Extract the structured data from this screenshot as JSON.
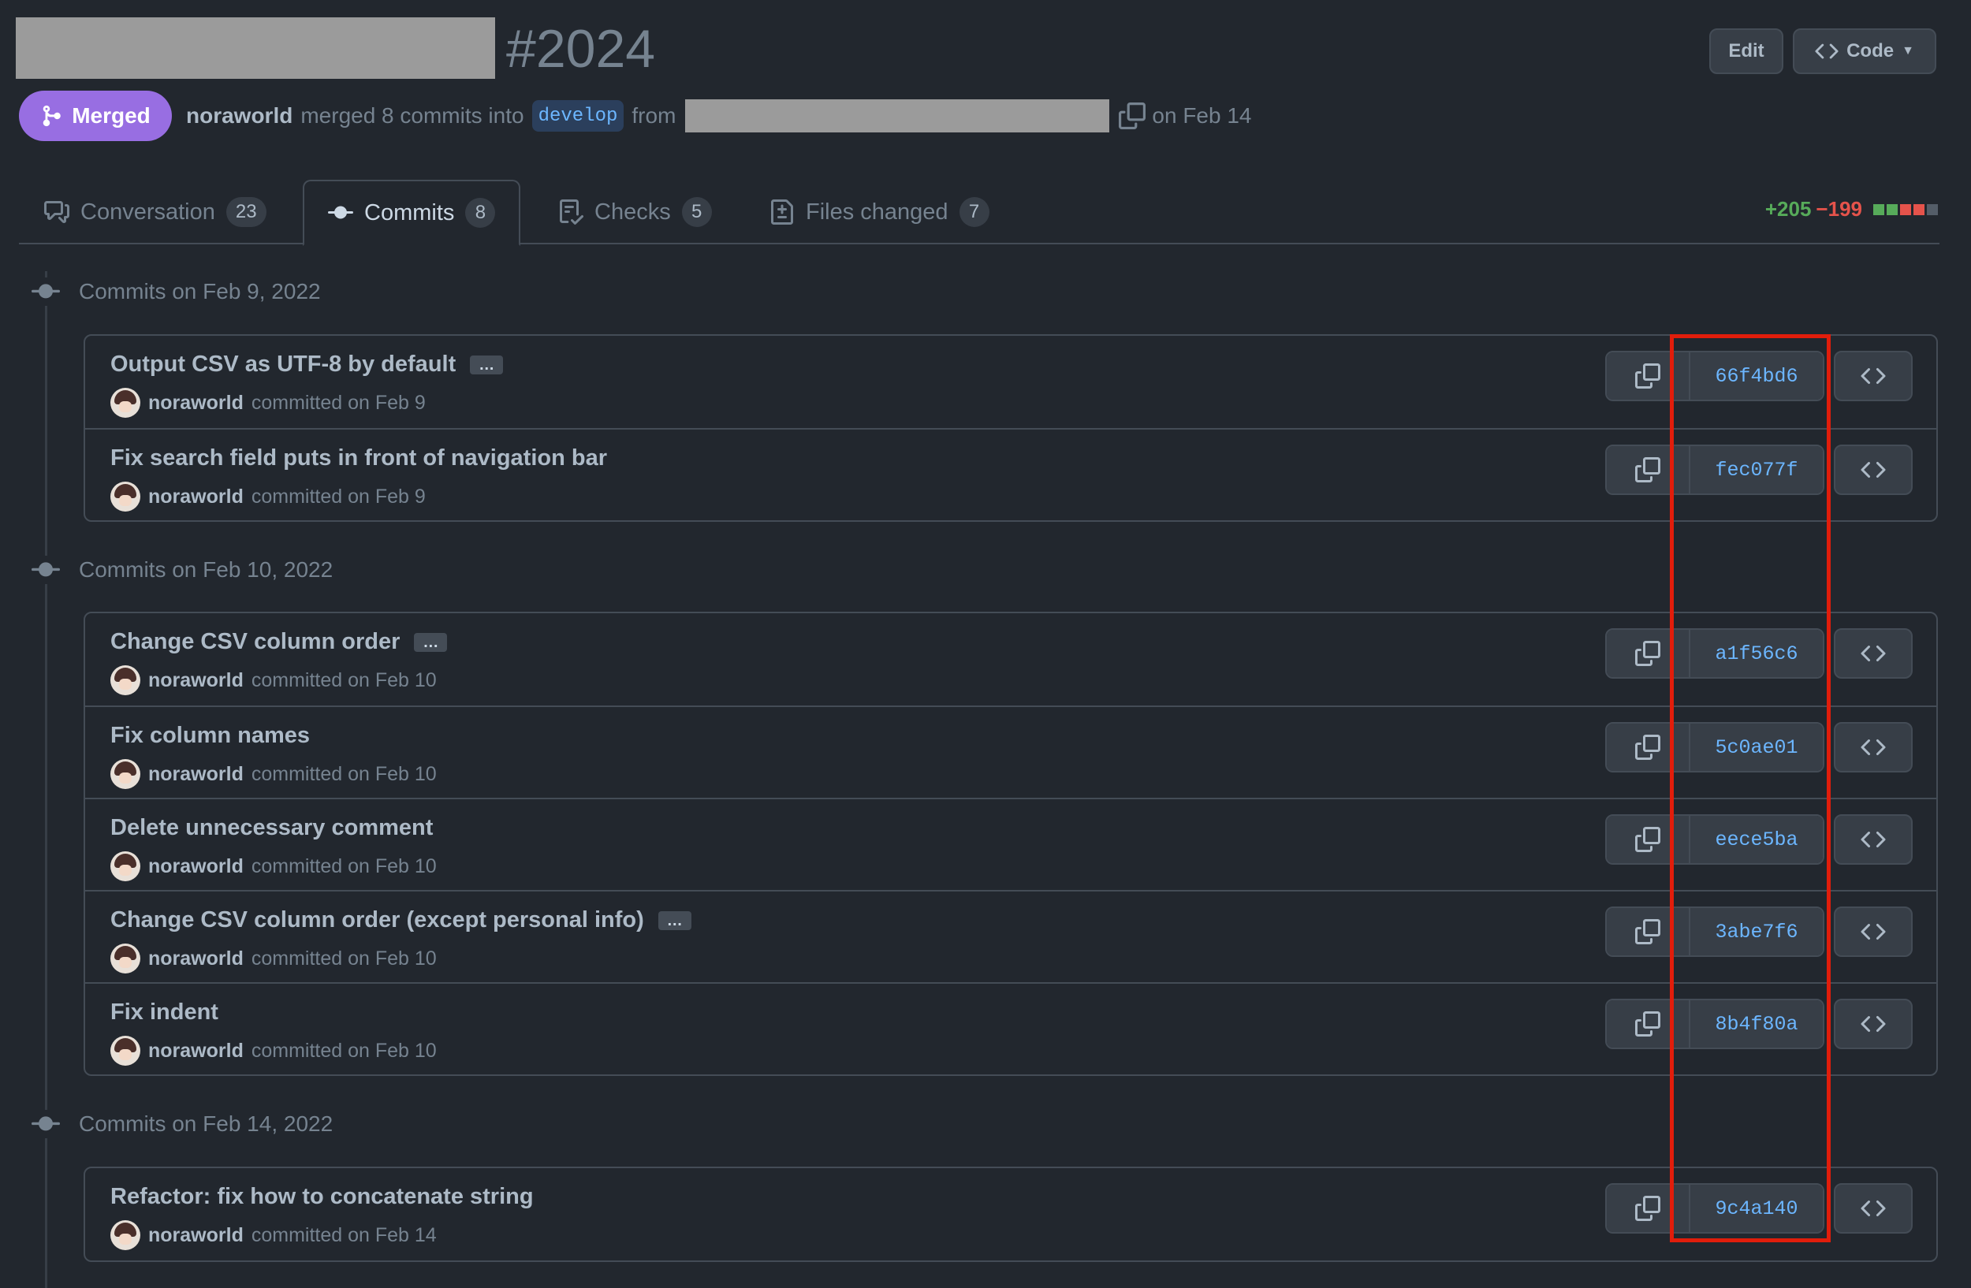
{
  "header": {
    "pr_number": "#2024",
    "edit_label": "Edit",
    "code_label": "Code"
  },
  "meta": {
    "status": "Merged",
    "author": "noraworld",
    "text_merged": "merged 8 commits into",
    "base_branch": "develop",
    "text_from": "from",
    "date": "on Feb 14"
  },
  "tabs": [
    {
      "label": "Conversation",
      "count": "23",
      "icon": "comment-discussion-icon"
    },
    {
      "label": "Commits",
      "count": "8",
      "icon": "git-commit-icon"
    },
    {
      "label": "Checks",
      "count": "5",
      "icon": "checklist-icon"
    },
    {
      "label": "Files changed",
      "count": "7",
      "icon": "file-diff-icon"
    }
  ],
  "diffstat": {
    "additions": "+205",
    "deletions": "−199",
    "blocks": [
      "#57ab5a",
      "#57ab5a",
      "#e5534b",
      "#e5534b",
      "#545d68"
    ]
  },
  "days": [
    {
      "label": "Commits on Feb 9, 2022"
    },
    {
      "label": "Commits on Feb 10, 2022"
    },
    {
      "label": "Commits on Feb 14, 2022"
    }
  ],
  "commits": [
    {
      "message": "Output CSV as UTF-8 by default",
      "author": "noraworld",
      "committed": "committed on Feb 9",
      "sha": "66f4bd6"
    },
    {
      "message": "Fix search field puts in front of navigation bar",
      "author": "noraworld",
      "committed": "committed on Feb 9",
      "sha": "fec077f"
    },
    {
      "message": "Change CSV column order",
      "author": "noraworld",
      "committed": "committed on Feb 10",
      "sha": "a1f56c6"
    },
    {
      "message": "Fix column names",
      "author": "noraworld",
      "committed": "committed on Feb 10",
      "sha": "5c0ae01"
    },
    {
      "message": "Delete unnecessary comment",
      "author": "noraworld",
      "committed": "committed on Feb 10",
      "sha": "eece5ba"
    },
    {
      "message": "Change CSV column order (except personal info)",
      "author": "noraworld",
      "committed": "committed on Feb 10",
      "sha": "3abe7f6"
    },
    {
      "message": "Fix indent",
      "author": "noraworld",
      "committed": "committed on Feb 10",
      "sha": "8b4f80a"
    },
    {
      "message": "Refactor: fix how to concatenate string",
      "author": "noraworld",
      "committed": "committed on Feb 14",
      "sha": "9c4a140"
    }
  ],
  "ellipsis_label": "…",
  "colors": {
    "background": "#22272e",
    "merged": "#986ee2",
    "link": "#6cb6ff",
    "highlight": "#e11d0b"
  }
}
